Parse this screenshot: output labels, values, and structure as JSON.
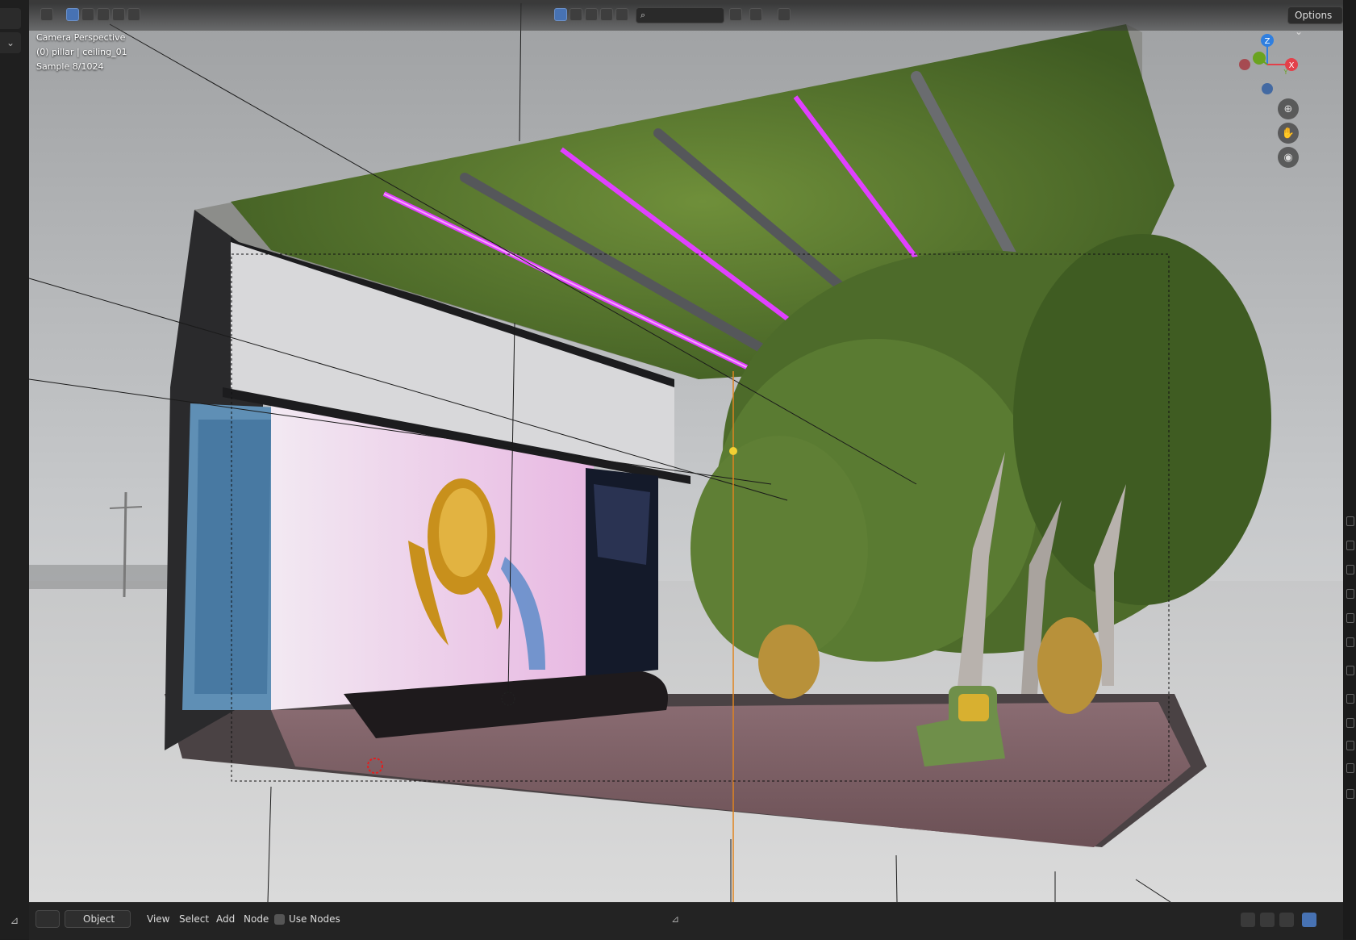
{
  "viewport": {
    "overlay_lines": [
      "Camera Perspective",
      "(0) pillar | ceiling_01",
      "Sample 8/1024"
    ]
  },
  "header": {
    "search_placeholder": "",
    "options_label": "Options",
    "options_chevron": "⌄"
  },
  "gizmo": {
    "axis_z": "Z",
    "axis_x": "X",
    "axis_y": "Y"
  },
  "footer": {
    "mode_label": "Object",
    "menus": [
      "View",
      "Select",
      "Add",
      "Node"
    ],
    "use_nodes_label": "Use Nodes"
  },
  "colors": {
    "accent": "#4772b3",
    "axis_x": "#e3404a",
    "axis_y": "#6aa31f",
    "axis_z": "#2f7fe0",
    "foliage": "#5b7a2e",
    "neon": "#e040ff"
  }
}
